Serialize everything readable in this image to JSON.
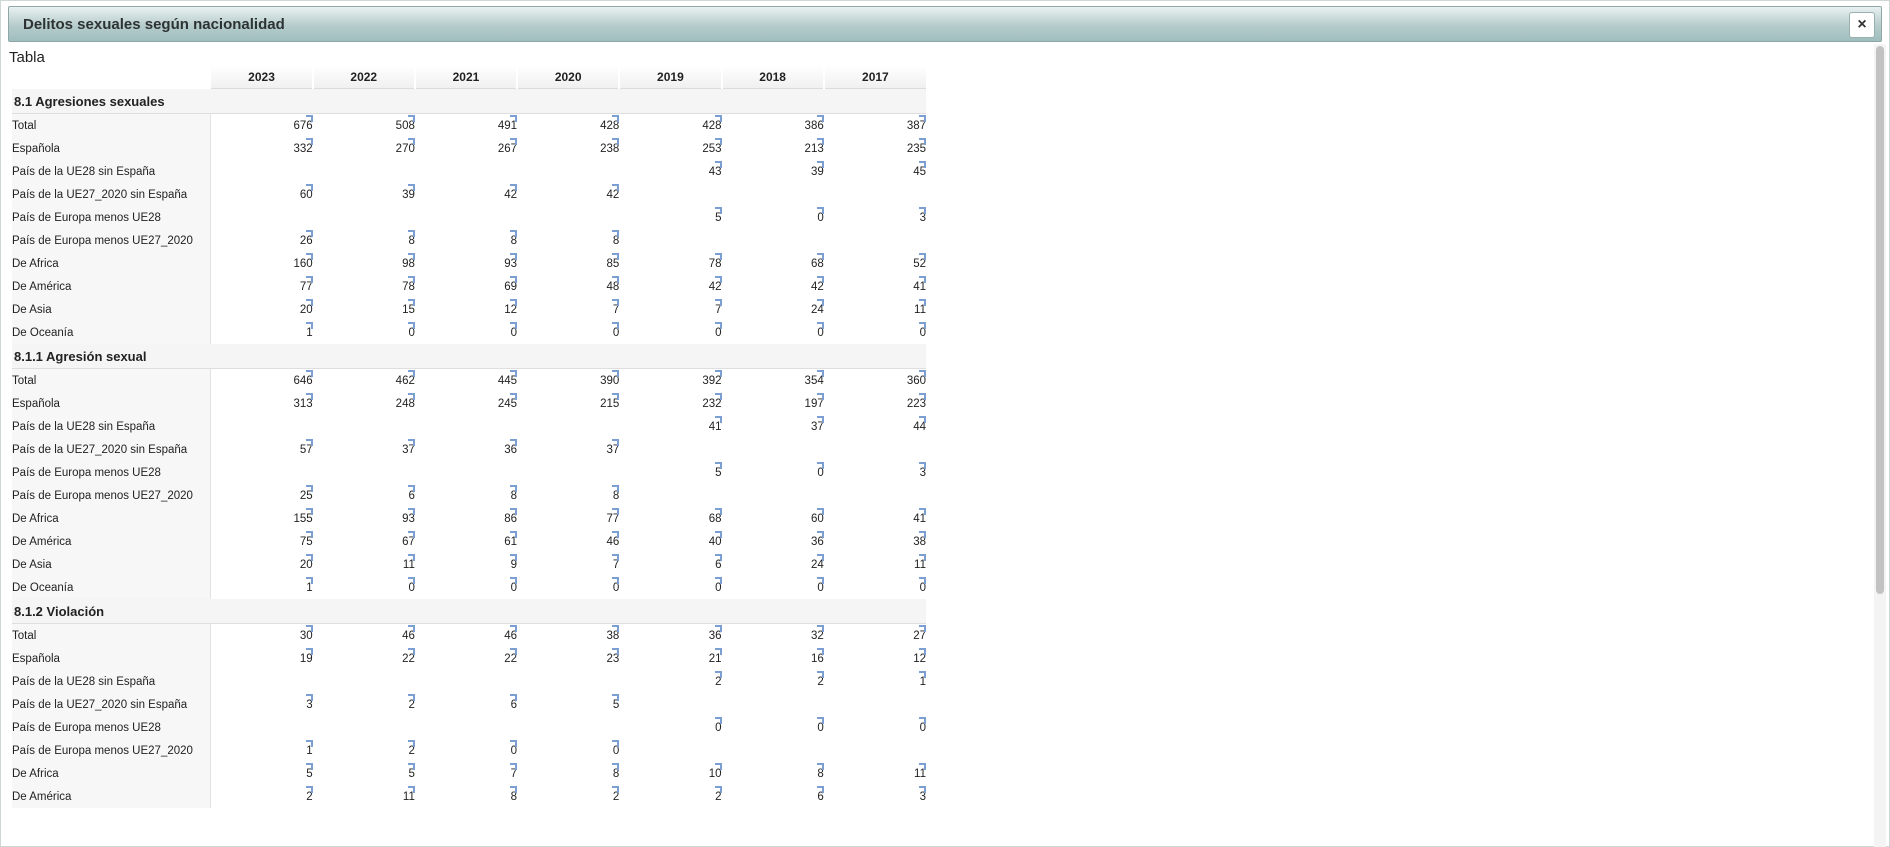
{
  "window": {
    "title": "Delitos sexuales según nacionalidad",
    "close_label": "×"
  },
  "view_label": "Tabla",
  "columns": [
    "2023",
    "2022",
    "2021",
    "2020",
    "2019",
    "2018",
    "2017"
  ],
  "sections": [
    {
      "title": "8.1 Agresiones sexuales",
      "rows": [
        {
          "label": "Total",
          "values": [
            "676",
            "508",
            "491",
            "428",
            "428",
            "386",
            "387"
          ]
        },
        {
          "label": "Española",
          "values": [
            "332",
            "270",
            "267",
            "238",
            "253",
            "213",
            "235"
          ]
        },
        {
          "label": "País de la UE28 sin España",
          "values": [
            "",
            "",
            "",
            "",
            "43",
            "39",
            "45"
          ]
        },
        {
          "label": "País de la UE27_2020 sin España",
          "values": [
            "60",
            "39",
            "42",
            "42",
            "",
            "",
            ""
          ]
        },
        {
          "label": "País de Europa menos UE28",
          "values": [
            "",
            "",
            "",
            "",
            "5",
            "0",
            "3"
          ]
        },
        {
          "label": "País de Europa menos UE27_2020",
          "values": [
            "26",
            "8",
            "8",
            "8",
            "",
            "",
            ""
          ]
        },
        {
          "label": "De Africa",
          "values": [
            "160",
            "98",
            "93",
            "85",
            "78",
            "68",
            "52"
          ]
        },
        {
          "label": "De América",
          "values": [
            "77",
            "78",
            "69",
            "48",
            "42",
            "42",
            "41"
          ]
        },
        {
          "label": "De Asia",
          "values": [
            "20",
            "15",
            "12",
            "7",
            "7",
            "24",
            "11"
          ]
        },
        {
          "label": "De Oceanía",
          "values": [
            "1",
            "0",
            "0",
            "0",
            "0",
            "0",
            "0"
          ]
        }
      ]
    },
    {
      "title": "8.1.1 Agresión sexual",
      "rows": [
        {
          "label": "Total",
          "values": [
            "646",
            "462",
            "445",
            "390",
            "392",
            "354",
            "360"
          ]
        },
        {
          "label": "Española",
          "values": [
            "313",
            "248",
            "245",
            "215",
            "232",
            "197",
            "223"
          ]
        },
        {
          "label": "País de la UE28 sin España",
          "values": [
            "",
            "",
            "",
            "",
            "41",
            "37",
            "44"
          ]
        },
        {
          "label": "País de la UE27_2020 sin España",
          "values": [
            "57",
            "37",
            "36",
            "37",
            "",
            "",
            ""
          ]
        },
        {
          "label": "País de Europa menos UE28",
          "values": [
            "",
            "",
            "",
            "",
            "5",
            "0",
            "3"
          ]
        },
        {
          "label": "País de Europa menos UE27_2020",
          "values": [
            "25",
            "6",
            "8",
            "8",
            "",
            "",
            ""
          ]
        },
        {
          "label": "De Africa",
          "values": [
            "155",
            "93",
            "86",
            "77",
            "68",
            "60",
            "41"
          ]
        },
        {
          "label": "De América",
          "values": [
            "75",
            "67",
            "61",
            "46",
            "40",
            "36",
            "38"
          ]
        },
        {
          "label": "De Asia",
          "values": [
            "20",
            "11",
            "9",
            "7",
            "6",
            "24",
            "11"
          ]
        },
        {
          "label": "De Oceanía",
          "values": [
            "1",
            "0",
            "0",
            "0",
            "0",
            "0",
            "0"
          ]
        }
      ]
    },
    {
      "title": "8.1.2 Violación",
      "rows": [
        {
          "label": "Total",
          "values": [
            "30",
            "46",
            "46",
            "38",
            "36",
            "32",
            "27"
          ]
        },
        {
          "label": "Española",
          "values": [
            "19",
            "22",
            "22",
            "23",
            "21",
            "16",
            "12"
          ]
        },
        {
          "label": "País de la UE28 sin España",
          "values": [
            "",
            "",
            "",
            "",
            "2",
            "2",
            "1"
          ]
        },
        {
          "label": "País de la UE27_2020 sin España",
          "values": [
            "3",
            "2",
            "6",
            "5",
            "",
            "",
            ""
          ]
        },
        {
          "label": "País de Europa menos UE28",
          "values": [
            "",
            "",
            "",
            "",
            "0",
            "0",
            "0"
          ]
        },
        {
          "label": "País de Europa menos UE27_2020",
          "values": [
            "1",
            "2",
            "0",
            "0",
            "",
            "",
            ""
          ]
        },
        {
          "label": "De Africa",
          "values": [
            "5",
            "5",
            "7",
            "8",
            "10",
            "8",
            "11"
          ]
        },
        {
          "label": "De América",
          "values": [
            "2",
            "11",
            "8",
            "2",
            "2",
            "6",
            "3"
          ]
        }
      ]
    }
  ]
}
